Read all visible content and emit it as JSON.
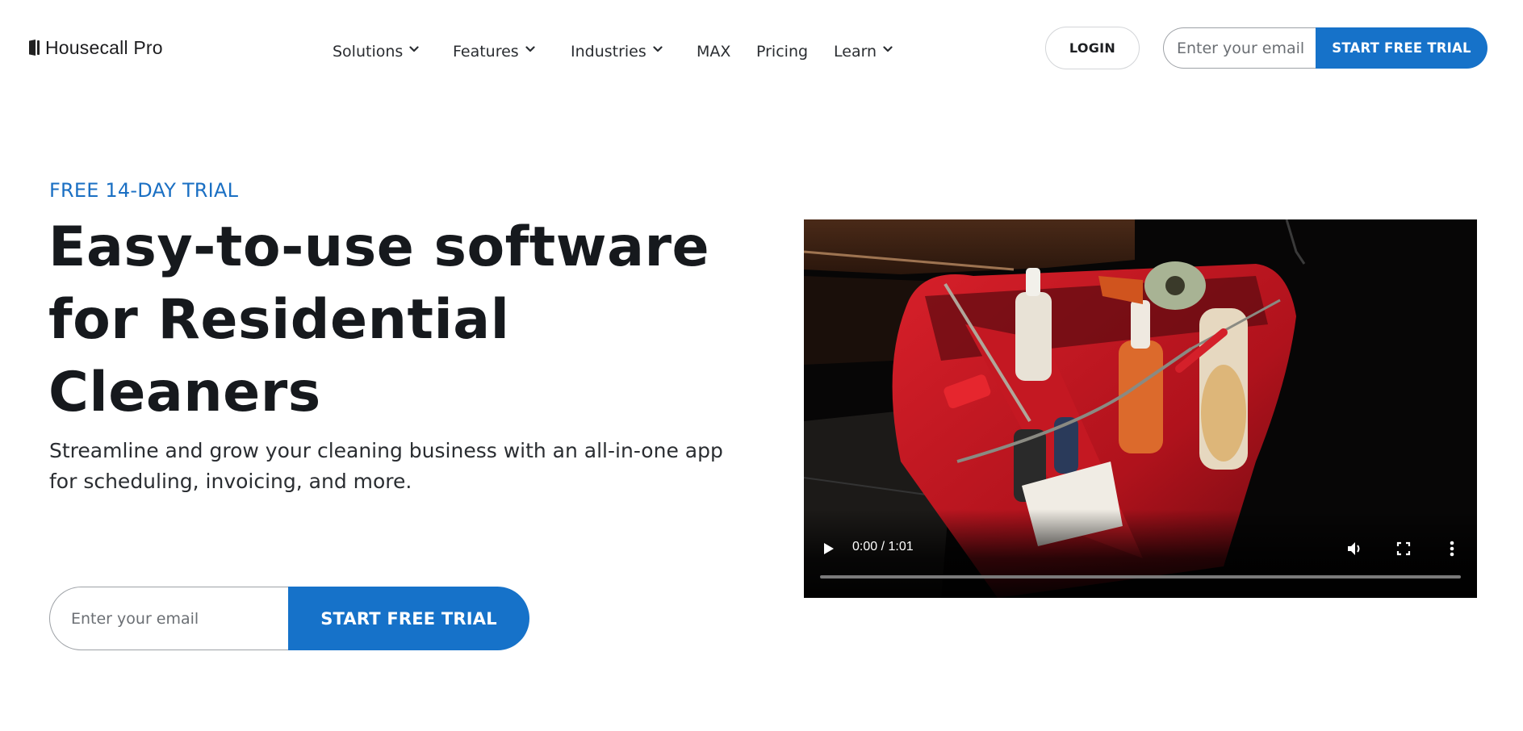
{
  "brand": {
    "name": "Housecall Pro",
    "logo_icon": "door-icon",
    "primary_color": "#1672c9",
    "eyebrow_color": "#1a6fc3"
  },
  "nav": {
    "items": [
      {
        "label": "Solutions",
        "has_dropdown": true
      },
      {
        "label": "Features",
        "has_dropdown": true
      },
      {
        "label": "Industries",
        "has_dropdown": true
      },
      {
        "label": "MAX",
        "has_dropdown": false
      },
      {
        "label": "Pricing",
        "has_dropdown": false
      },
      {
        "label": "Learn",
        "has_dropdown": true
      }
    ]
  },
  "header": {
    "login_label": "LOGIN",
    "email_placeholder": "Enter your email",
    "email_value": "",
    "cta_label": "START FREE TRIAL"
  },
  "hero": {
    "eyebrow": "FREE 14-DAY TRIAL",
    "headline": "Easy-to-use software for Residential Cleaners",
    "subhead": "Streamline and grow your cleaning business with an all-in-one app for scheduling, invoicing, and more.",
    "email_placeholder": "Enter your email",
    "email_value": "",
    "cta_label": "START FREE TRIAL"
  },
  "video": {
    "current_time": "0:00",
    "duration": "1:01",
    "time_display": "0:00 / 1:01",
    "progress_fraction": 0,
    "state": "paused",
    "controls": [
      "play-icon",
      "volume-icon",
      "fullscreen-icon",
      "more-options-icon"
    ]
  }
}
